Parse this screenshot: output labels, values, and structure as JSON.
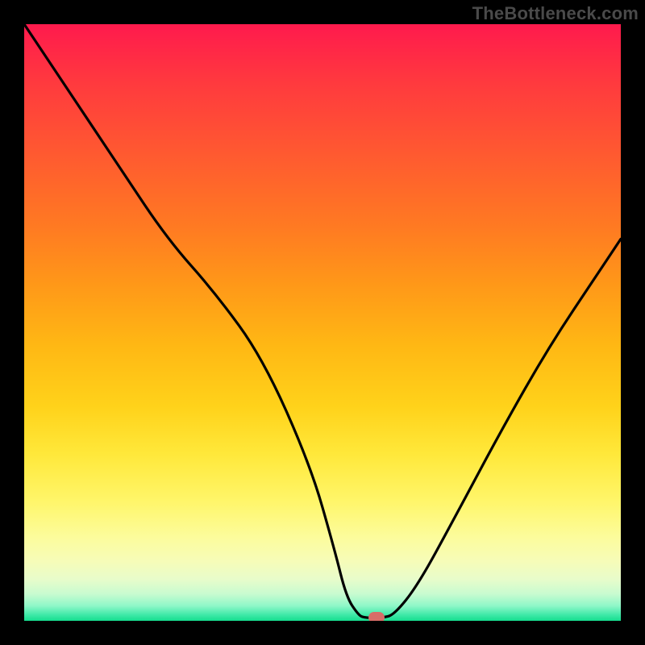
{
  "watermark": "TheBottleneck.com",
  "chart_data": {
    "type": "line",
    "title": "",
    "xlabel": "",
    "ylabel": "",
    "xlim": [
      0,
      100
    ],
    "ylim": [
      0,
      100
    ],
    "grid": false,
    "series": [
      {
        "name": "curve",
        "x": [
          0,
          8,
          16,
          24,
          32,
          40,
          48,
          52,
          54,
          56,
          57,
          60,
          62,
          66,
          72,
          80,
          88,
          96,
          100
        ],
        "y": [
          100,
          88,
          76,
          64,
          55,
          44,
          26,
          12,
          4,
          1,
          0.5,
          0.5,
          1,
          6,
          17,
          32,
          46,
          58,
          64
        ]
      }
    ],
    "marker": {
      "x": 59,
      "y": 0.5
    },
    "background_gradient": {
      "top": "#ff1a4d",
      "mid": "#ffd21a",
      "bottom": "#15dd8e"
    }
  }
}
